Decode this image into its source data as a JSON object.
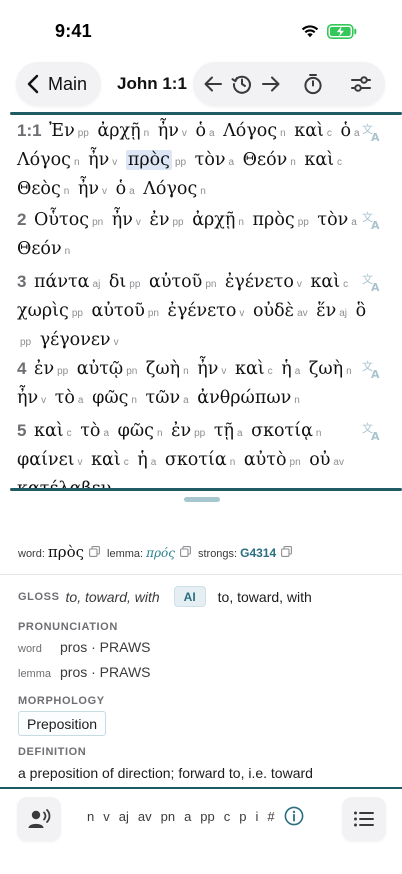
{
  "status": {
    "time": "9:41"
  },
  "nav": {
    "back_label": "Main",
    "title": "John 1:1"
  },
  "reader": {
    "verses": [
      {
        "lines": [
          [
            {
              "t": "1:1",
              "k": "num"
            },
            {
              "t": "Ἐν",
              "k": "w"
            },
            {
              "t": "pp",
              "k": "p"
            },
            {
              "t": "ἀρχῇ",
              "k": "w"
            },
            {
              "t": "n",
              "k": "p"
            },
            {
              "t": "ἦν",
              "k": "w"
            },
            {
              "t": "v",
              "k": "p"
            },
            {
              "t": "ὁ",
              "k": "w"
            },
            {
              "t": "a",
              "k": "p"
            },
            {
              "t": "Λόγος",
              "k": "w"
            },
            {
              "t": "n",
              "k": "p"
            },
            {
              "t": "καὶ",
              "k": "w"
            },
            {
              "t": "c",
              "k": "p"
            },
            {
              "t": "ὁ",
              "k": "w"
            },
            {
              "t": "a",
              "k": "p"
            }
          ],
          [
            {
              "t": "Λόγος",
              "k": "w"
            },
            {
              "t": "n",
              "k": "p"
            },
            {
              "t": "ἦν",
              "k": "w"
            },
            {
              "t": "v",
              "k": "p"
            },
            {
              "t": "πρὸς",
              "k": "sel"
            },
            {
              "t": "pp",
              "k": "p"
            },
            {
              "t": "τὸν",
              "k": "w"
            },
            {
              "t": "a",
              "k": "p"
            },
            {
              "t": "Θεόν",
              "k": "w"
            },
            {
              "t": "n",
              "k": "p"
            },
            {
              "t": "καὶ",
              "k": "w"
            },
            {
              "t": "c",
              "k": "p"
            }
          ],
          [
            {
              "t": "Θεὸς",
              "k": "w"
            },
            {
              "t": "n",
              "k": "p"
            },
            {
              "t": "ἦν",
              "k": "w"
            },
            {
              "t": "v",
              "k": "p"
            },
            {
              "t": "ὁ",
              "k": "w"
            },
            {
              "t": "a",
              "k": "p"
            },
            {
              "t": "Λόγος",
              "k": "w"
            },
            {
              "t": "n",
              "k": "p"
            }
          ]
        ]
      },
      {
        "lines": [
          [
            {
              "t": "2",
              "k": "num"
            },
            {
              "t": "Οὗτος",
              "k": "w"
            },
            {
              "t": "pn",
              "k": "p"
            },
            {
              "t": "ἦν",
              "k": "w"
            },
            {
              "t": "v",
              "k": "p"
            },
            {
              "t": "ἐν",
              "k": "w"
            },
            {
              "t": "pp",
              "k": "p"
            },
            {
              "t": "ἀρχῇ",
              "k": "w"
            },
            {
              "t": "n",
              "k": "p"
            },
            {
              "t": "πρὸς",
              "k": "w"
            },
            {
              "t": "pp",
              "k": "p"
            },
            {
              "t": "τὸν",
              "k": "w"
            },
            {
              "t": "a",
              "k": "p"
            }
          ],
          [
            {
              "t": "Θεόν",
              "k": "w"
            },
            {
              "t": "n",
              "k": "p"
            }
          ]
        ]
      },
      {
        "lines": [
          [
            {
              "t": "3",
              "k": "num"
            },
            {
              "t": "πάντα",
              "k": "w"
            },
            {
              "t": "aj",
              "k": "p"
            },
            {
              "t": "δι",
              "k": "w"
            },
            {
              "t": "pp",
              "k": "p"
            },
            {
              "t": "αὐτοῦ",
              "k": "w"
            },
            {
              "t": "pn",
              "k": "p"
            },
            {
              "t": "ἐγένετο",
              "k": "w"
            },
            {
              "t": "v",
              "k": "p"
            },
            {
              "t": "καὶ",
              "k": "w"
            },
            {
              "t": "c",
              "k": "p"
            }
          ],
          [
            {
              "t": "χωρὶς",
              "k": "w"
            },
            {
              "t": "pp",
              "k": "p"
            },
            {
              "t": "αὐτοῦ",
              "k": "w"
            },
            {
              "t": "pn",
              "k": "p"
            },
            {
              "t": "ἐγένετο",
              "k": "w"
            },
            {
              "t": "v",
              "k": "p"
            },
            {
              "t": "οὐδὲ",
              "k": "w"
            },
            {
              "t": "av",
              "k": "p"
            },
            {
              "t": "ἕν",
              "k": "w"
            },
            {
              "t": "aj",
              "k": "p"
            },
            {
              "t": "ὃ",
              "k": "w"
            }
          ],
          [
            {
              "t": "pp",
              "k": "p"
            },
            {
              "t": "γέγονεν",
              "k": "w"
            },
            {
              "t": "v",
              "k": "p"
            }
          ]
        ]
      },
      {
        "lines": [
          [
            {
              "t": "4",
              "k": "num"
            },
            {
              "t": "ἐν",
              "k": "w"
            },
            {
              "t": "pp",
              "k": "p"
            },
            {
              "t": "αὐτῷ",
              "k": "w"
            },
            {
              "t": "pn",
              "k": "p"
            },
            {
              "t": "ζωὴ",
              "k": "w"
            },
            {
              "t": "n",
              "k": "p"
            },
            {
              "t": "ἦν",
              "k": "w"
            },
            {
              "t": "v",
              "k": "p"
            },
            {
              "t": "καὶ",
              "k": "w"
            },
            {
              "t": "c",
              "k": "p"
            },
            {
              "t": "ἡ",
              "k": "w"
            },
            {
              "t": "a",
              "k": "p"
            },
            {
              "t": "ζωὴ",
              "k": "w"
            },
            {
              "t": "n",
              "k": "p"
            }
          ],
          [
            {
              "t": "ἦν",
              "k": "w"
            },
            {
              "t": "v",
              "k": "p"
            },
            {
              "t": "τὸ",
              "k": "w"
            },
            {
              "t": "a",
              "k": "p"
            },
            {
              "t": "φῶς",
              "k": "w"
            },
            {
              "t": "n",
              "k": "p"
            },
            {
              "t": "τῶν",
              "k": "w"
            },
            {
              "t": "a",
              "k": "p"
            },
            {
              "t": "ἀνθρώπων",
              "k": "w"
            },
            {
              "t": "n",
              "k": "p"
            }
          ]
        ]
      },
      {
        "lines": [
          [
            {
              "t": "5",
              "k": "num"
            },
            {
              "t": "καὶ",
              "k": "w"
            },
            {
              "t": "c",
              "k": "p"
            },
            {
              "t": "τὸ",
              "k": "w"
            },
            {
              "t": "a",
              "k": "p"
            },
            {
              "t": "φῶς",
              "k": "w"
            },
            {
              "t": "n",
              "k": "p"
            },
            {
              "t": "ἐν",
              "k": "w"
            },
            {
              "t": "pp",
              "k": "p"
            },
            {
              "t": "τῇ",
              "k": "w"
            },
            {
              "t": "a",
              "k": "p"
            },
            {
              "t": "σκοτίᾳ",
              "k": "w"
            },
            {
              "t": "n",
              "k": "p"
            }
          ],
          [
            {
              "t": "φαίνει",
              "k": "w"
            },
            {
              "t": "v",
              "k": "p"
            },
            {
              "t": "καὶ",
              "k": "w"
            },
            {
              "t": "c",
              "k": "p"
            },
            {
              "t": "ἡ",
              "k": "w"
            },
            {
              "t": "a",
              "k": "p"
            },
            {
              "t": "σκοτία",
              "k": "w"
            },
            {
              "t": "n",
              "k": "p"
            },
            {
              "t": "αὐτὸ",
              "k": "w"
            },
            {
              "t": "pn",
              "k": "p"
            },
            {
              "t": "οὐ",
              "k": "w"
            },
            {
              "t": "av",
              "k": "p"
            }
          ],
          [
            {
              "t": "κατέλαβεν",
              "k": "w"
            },
            {
              "t": "v",
              "k": "p"
            }
          ]
        ]
      }
    ]
  },
  "detail": {
    "word_key": "word:",
    "word": "πρὸς",
    "lemma_key": "lemma:",
    "lemma": "πρός",
    "strongs_key": "strongs:",
    "strongs": "G4314",
    "gloss_label": "GLOSS",
    "gloss": "to, toward, with",
    "ai_button": "AI",
    "ai_gloss": "to, toward, with",
    "pronunciation_label": "PRONUNCIATION",
    "pron_word_key": "word",
    "pron_word": "pros · PRAWS",
    "pron_lemma_key": "lemma",
    "pron_lemma": "pros · PRAWS",
    "morphology_label": "MORPHOLOGY",
    "morphology": "Preposition",
    "definition_label": "DEFINITION",
    "definition": "a preposition of direction; forward to, i.e. toward"
  },
  "toolbar": {
    "pos_filters": [
      "n",
      "v",
      "aj",
      "av",
      "pn",
      "a",
      "pp",
      "c",
      "p",
      "i",
      "#"
    ]
  },
  "colors": {
    "accent": "#1f5b63",
    "link": "#2a7f8f",
    "selection": "#dde6f5"
  }
}
